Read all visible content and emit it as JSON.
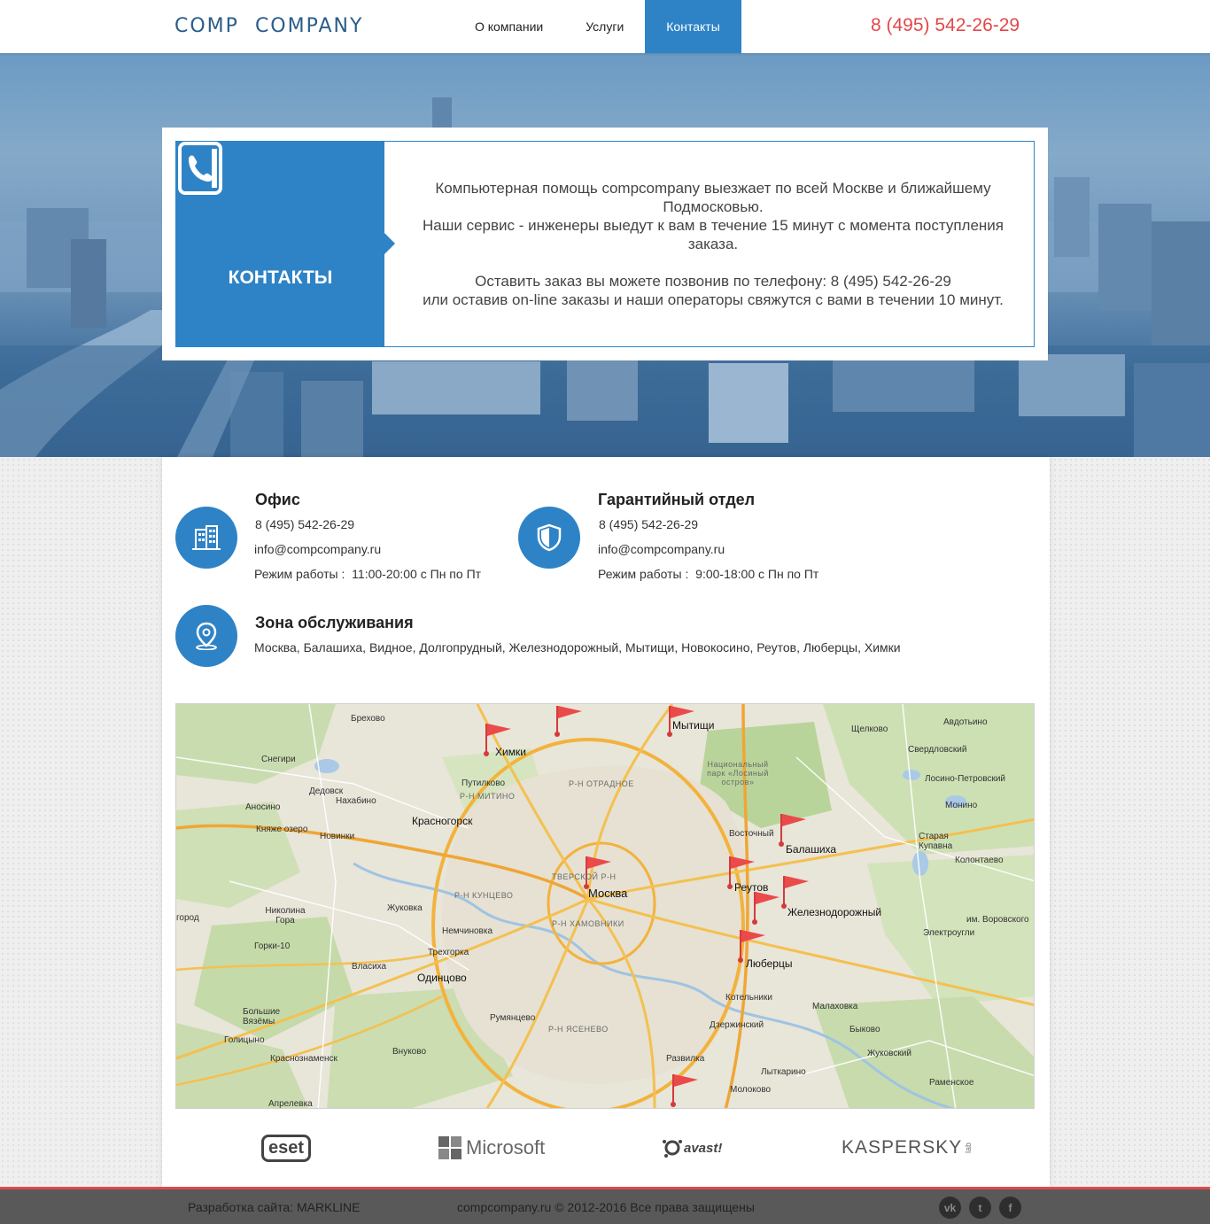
{
  "header": {
    "logo_part1": "Comp",
    "logo_part2": "Company",
    "nav": [
      {
        "label": "О компании"
      },
      {
        "label": "Услуги"
      },
      {
        "label": "Контакты",
        "active": true
      }
    ],
    "phone": "8 (495) 542-26-29"
  },
  "hero": {
    "title": "КОНТАКТЫ",
    "icon": "phone-book-icon",
    "lines": [
      "Компьютерная помощь compcompany выезжает по всей Москве и ближайшему Подмосковью.",
      "Наши сервис - инженеры выедут к вам в течение 15 минут с момента поступления заказа.",
      "Оставить заказ вы можете позвонив по телефону: 8 (495) 542-26-29",
      "или оставив on-line заказы и наши операторы свяжутся с вами в течении 10 минут."
    ]
  },
  "office": {
    "title": "Офис",
    "phone": "8 (495) 542-26-29",
    "email": "info@compcompany.ru",
    "hours_label": "Режим работы :",
    "hours": "11:00-20:00 с Пн по Пт",
    "icon": "building-icon"
  },
  "warranty": {
    "title": "Гарантийный отдел",
    "phone": "8 (495) 542-26-29",
    "email": "info@compcompany.ru",
    "hours_label": "Режим работы :",
    "hours": "9:00-18:00 с Пн по Пт",
    "icon": "shield-icon"
  },
  "zone": {
    "title": "Зона обслуживания",
    "cities": "Москва, Балашиха, Видное, Долгопрудный, Железнодорожный, Мытищи, Новокосино, Реутов, Люберцы, Химки",
    "icon": "location-pin-icon"
  },
  "map": {
    "labels": {
      "moscow": "Москва",
      "khimki": "Химки",
      "mytishchi": "Мытищи",
      "balashikha": "Балашиха",
      "reutov": "Реутов",
      "zhel": "Железнодорожный",
      "lyubertsy": "Люберцы",
      "krasnogorsk": "Красногорск",
      "odintsovo": "Одинцово",
      "shchelkovo": "Щелково",
      "dzerzhinsky": "Дзержинский",
      "zhukovsky": "Жуковский",
      "ramenskoe": "Раменское",
      "vnukovo": "Внуково",
      "razvilka": "Развилка",
      "breh": "Брехово",
      "snegiri": "Снегири",
      "dedovsk": "Дедовск",
      "anosino": "Аносино",
      "nakhabino": "Нахабино",
      "putilkovo": "Путилково",
      "knyazhe": "Княже озеро",
      "novinki": "Новинки",
      "zhukovka": "Жуковка",
      "nikolina": "Николина Гора",
      "gorki": "Горки-10",
      "vlasikha": "Власиха",
      "nemchinovka": "Немчиновка",
      "trekhgorka": "Трехгорка",
      "rumyantsevo": "Румянцево",
      "bolshie": "Большие Вязёмы",
      "golitsyno": "Голицыно",
      "krasnoznamensk": "Краснознаменск",
      "aprelevka": "Апрелевка",
      "kotelniki": "Котельники",
      "malakhovka": "Малаховка",
      "bykovo": "Быково",
      "lytkarino": "Лыткарино",
      "molokovo": "Молоково",
      "vostochny": "Восточный",
      "staraya": "Старая Купавна",
      "kolontaevo": "Колонтаево",
      "monino": "Монино",
      "losino": "Лосино-Петровский",
      "sverdlovsky": "Свердловский",
      "avdotino": "Авдотьино",
      "elektrougli": "Электроугли",
      "vorovskogo": "им. Воровского",
      "park": "Национальный парк «Лосиный остров»",
      "otradnoe": "Р-Н ОТРАДНОЕ",
      "mitino": "Р-Н МИТИНО",
      "kuntsevo": "Р-Н КУНЦЕВО",
      "tverskoy": "ТВЕРСКОЙ Р-Н",
      "khamovniki": "Р-Н ХАМОВНИКИ",
      "yasenevo": "Р-Н ЯСЕНЕВО",
      "gorod": "город"
    }
  },
  "brands": [
    {
      "name": "eset"
    },
    {
      "name": "Microsoft"
    },
    {
      "name": "avast!"
    },
    {
      "name": "KASPERSKY",
      "suffix": "lab"
    }
  ],
  "footer": {
    "dev": "Разработка сайта: MARKLINE",
    "copyright": "compcompany.ru © 2012-2016 Все права защищены",
    "social": [
      {
        "icon": "vk-icon",
        "glyph": "vk"
      },
      {
        "icon": "twitter-icon",
        "glyph": "t"
      },
      {
        "icon": "facebook-icon",
        "glyph": "f"
      }
    ]
  }
}
